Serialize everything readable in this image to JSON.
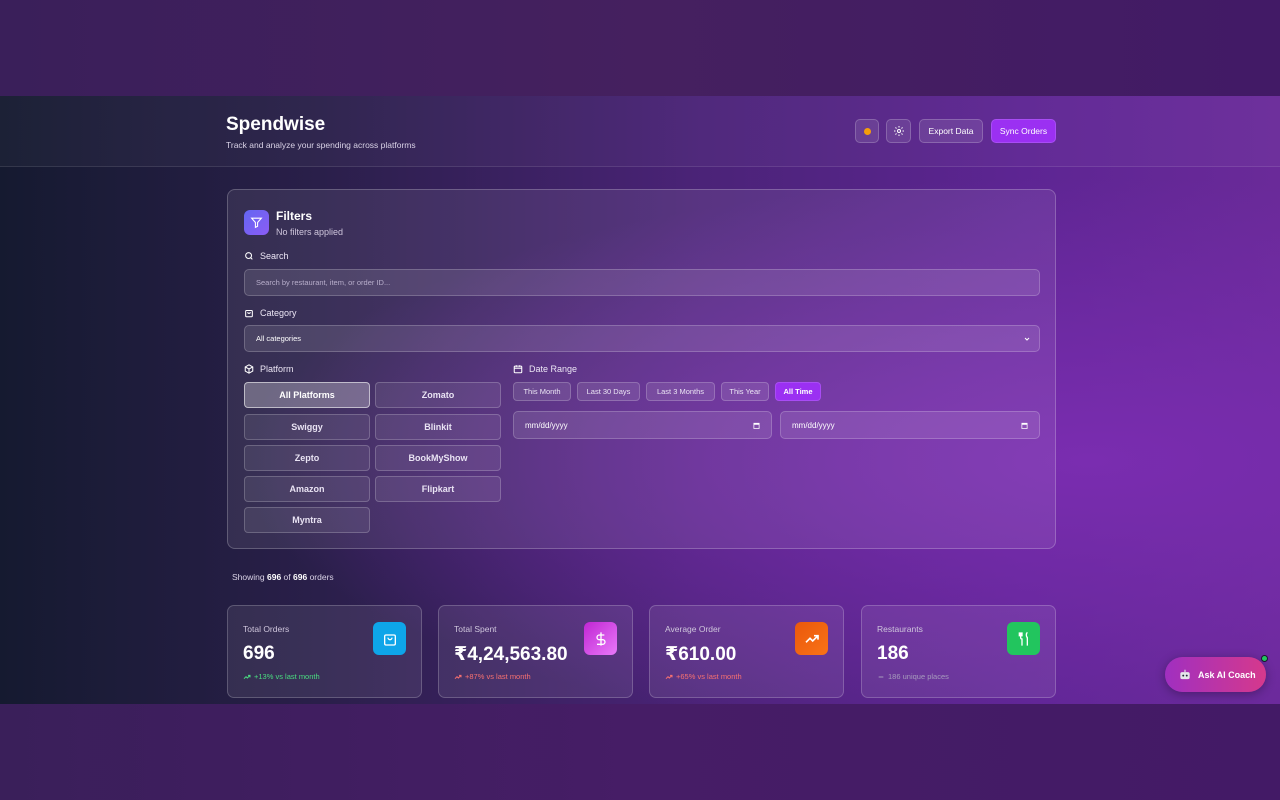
{
  "app": {
    "title": "Spendwise",
    "subtitle": "Track and analyze your spending across platforms",
    "export_label": "Export Data",
    "sync_label": "Sync Orders"
  },
  "filters": {
    "title": "Filters",
    "status": "No filters applied",
    "search": {
      "label": "Search",
      "placeholder": "Search by restaurant, item, or order ID..."
    },
    "category": {
      "label": "Category",
      "selected": "All categories"
    },
    "platform": {
      "label": "Platform",
      "options": [
        "All Platforms",
        "Zomato",
        "Swiggy",
        "Blinkit",
        "Zepto",
        "BookMyShow",
        "Amazon",
        "Flipkart",
        "Myntra"
      ],
      "selected": "All Platforms"
    },
    "date_range": {
      "label": "Date Range",
      "presets": [
        "This Month",
        "Last 30 Days",
        "Last 3 Months",
        "This Year",
        "All Time"
      ],
      "selected": "All Time",
      "start_placeholder": "mm/dd/yyyy",
      "end_placeholder": "mm/dd/yyyy"
    }
  },
  "results": {
    "prefix": "Showing",
    "shown": "696",
    "of": "of",
    "total": "696",
    "suffix": "orders"
  },
  "stats": [
    {
      "title": "Total Orders",
      "value": "696",
      "trend": "+13% vs last month",
      "trend_color": "#4ade80",
      "icon": "shopping-bag-icon",
      "icon_color": "#0ea5e9"
    },
    {
      "title": "Total Spent",
      "value": "₹4,24,563.80",
      "trend": "+87% vs last month",
      "trend_color": "#f87171",
      "icon": "dollar-icon",
      "icon_color": "#d946ef"
    },
    {
      "title": "Average Order",
      "value": "₹610.00",
      "trend": "+65% vs last month",
      "trend_color": "#f87171",
      "icon": "trending-up-icon",
      "icon_color": "#f97316"
    },
    {
      "title": "Restaurants",
      "value": "186",
      "trend": "186 unique places",
      "trend_color": "#a79bbd",
      "icon": "utensils-icon",
      "icon_color": "#22c55e"
    }
  ],
  "ai_coach": {
    "label": "Ask AI Coach"
  },
  "colors": {
    "accent": "#9b30f2",
    "theme_dot": "#f59e0b"
  }
}
